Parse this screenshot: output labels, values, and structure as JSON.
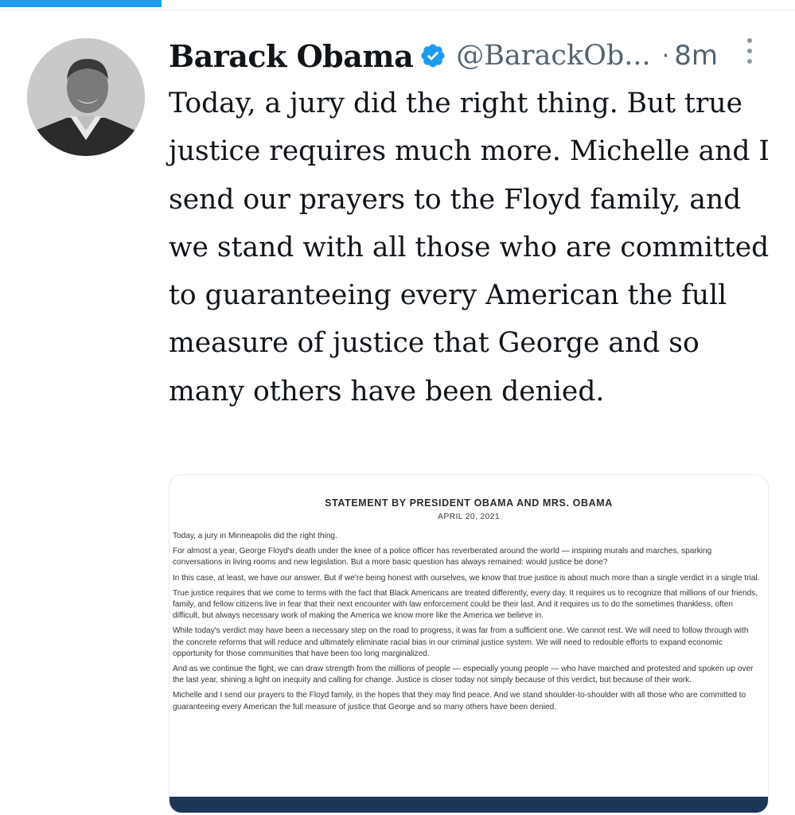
{
  "app": {
    "accent_color": "#1d9bf0",
    "verified_color": "#1d9bf0",
    "secondary_text_color": "#536471"
  },
  "tweet": {
    "author": {
      "display_name": "Barack Obama",
      "handle": "@BarackOb...",
      "verified": true,
      "avatar_icon": "profile-photo"
    },
    "separator": "·",
    "timestamp": "8m",
    "more_icon": "more-vertical-icon",
    "text": "Today, a jury did the right thing. But true justice requires much more. Michelle and I send our prayers to the Floyd family, and we stand with all those who are committed to guaranteeing every American the full measure of justice that George and so many others have been denied.",
    "media": {
      "title": "STATEMENT BY PRESIDENT OBAMA AND MRS. OBAMA",
      "date": "APRIL 20, 2021",
      "paragraphs": [
        "Today, a jury in Minneapolis did the right thing.",
        "For almost a year, George Floyd's death under the knee of a police officer has reverberated around the world — inspiring murals and marches, sparking conversations in living rooms and new legislation. But a more basic question has always remained: would justice be done?",
        "In this case, at least, we have our answer. But if we're being honest with ourselves, we know that true justice is about much more than a single verdict in a single trial.",
        "True justice requires that we come to terms with the fact that Black Americans are treated differently, every day. It requires us to recognize that millions of our friends, family, and fellow citizens live in fear that their next encounter with law enforcement could be their last. And it requires us to do the sometimes thankless, often difficult, but always necessary work of making the America we know more like the America we believe in.",
        "While today's verdict may have been a necessary step on the road to progress, it was far from a sufficient one. We cannot rest. We will need to follow through with the concrete reforms that will reduce and ultimately eliminate racial bias in our criminal justice system. We will need to redouble efforts to expand economic opportunity for those communities that have been too long marginalized.",
        "And as we continue the fight, we can draw strength from the millions of people — especially young people — who have marched and protested and spoken up over the last year, shining a light on inequity and calling for change. Justice is closer today not simply because of this verdict, but because of their work.",
        "Michelle and I send our prayers to the Floyd family, in the hopes that they may find peace. And we stand shoulder-to-shoulder with all those who are committed to guaranteeing every American the full measure of justice that George and so many others have been denied."
      ]
    }
  }
}
